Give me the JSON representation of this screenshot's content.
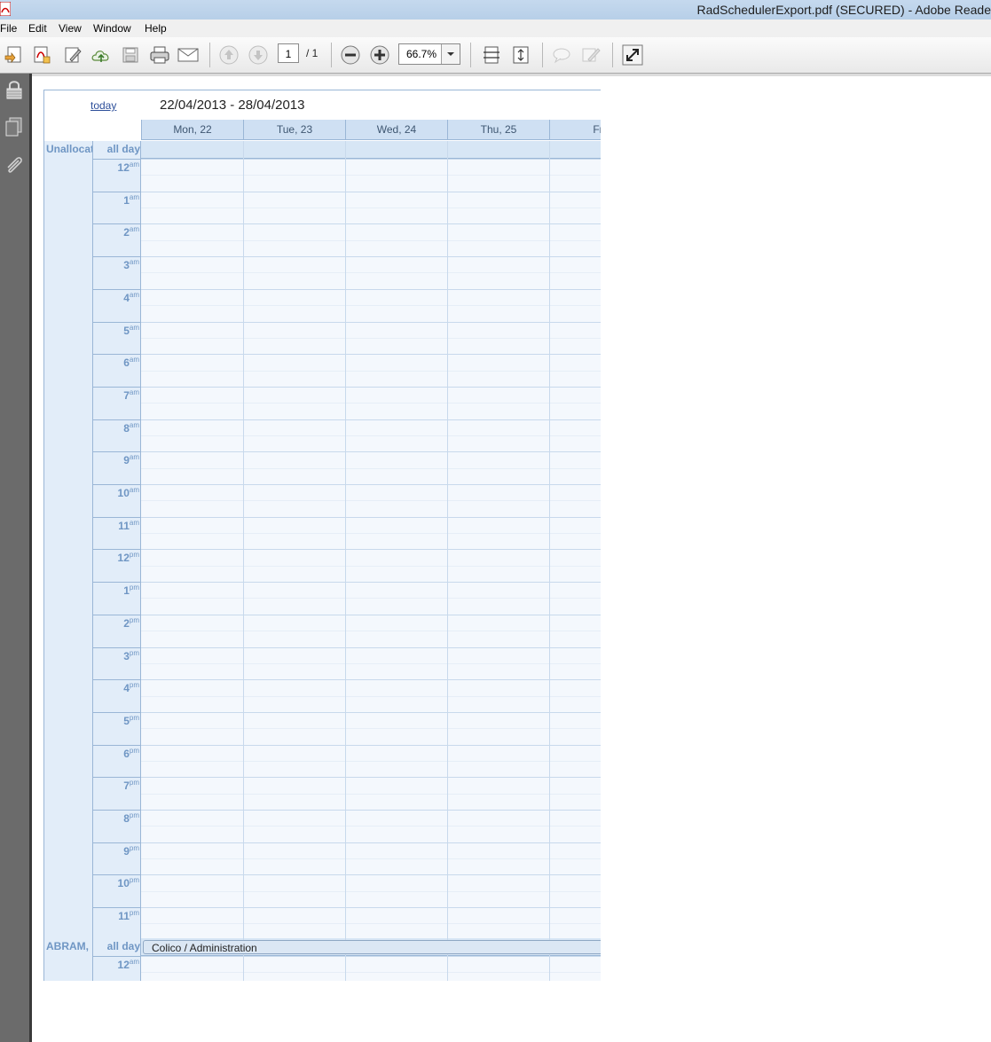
{
  "window": {
    "title": "RadSchedulerExport.pdf (SECURED) - Adobe Reade"
  },
  "menu": [
    "File",
    "Edit",
    "View",
    "Window",
    "Help"
  ],
  "toolbar": {
    "page_current": "1",
    "page_total": "/ 1",
    "zoom": "66.7%",
    "icons": [
      "create-pdf-icon",
      "export-pdf-icon",
      "edit-icon",
      "upload-icon",
      "save-icon",
      "print-icon",
      "email-icon",
      "previous-page-icon",
      "next-page-icon",
      "zoom-out-icon",
      "zoom-in-icon",
      "fit-page-icon",
      "fit-width-icon",
      "comment-icon",
      "sign-icon",
      "full-screen-icon"
    ]
  },
  "left_panel": {
    "icons": [
      "lock-icon",
      "pages-icon",
      "attachment-icon"
    ]
  },
  "scheduler": {
    "today_label": "today",
    "date_range": "22/04/2013 - 28/04/2013",
    "days": [
      "Mon, 22",
      "Tue, 23",
      "Wed, 24",
      "Thu, 25",
      "Fri,"
    ],
    "resources": [
      {
        "name": "Unallocat"
      },
      {
        "name": "ABRAM, I"
      }
    ],
    "all_day_label": "all day",
    "hours": [
      {
        "h": "12",
        "p": "am"
      },
      {
        "h": "1",
        "p": "am"
      },
      {
        "h": "2",
        "p": "am"
      },
      {
        "h": "3",
        "p": "am"
      },
      {
        "h": "4",
        "p": "am"
      },
      {
        "h": "5",
        "p": "am"
      },
      {
        "h": "6",
        "p": "am"
      },
      {
        "h": "7",
        "p": "am"
      },
      {
        "h": "8",
        "p": "am"
      },
      {
        "h": "9",
        "p": "am"
      },
      {
        "h": "10",
        "p": "am"
      },
      {
        "h": "11",
        "p": "am"
      },
      {
        "h": "12",
        "p": "pm"
      },
      {
        "h": "1",
        "p": "pm"
      },
      {
        "h": "2",
        "p": "pm"
      },
      {
        "h": "3",
        "p": "pm"
      },
      {
        "h": "4",
        "p": "pm"
      },
      {
        "h": "5",
        "p": "pm"
      },
      {
        "h": "6",
        "p": "pm"
      },
      {
        "h": "7",
        "p": "pm"
      },
      {
        "h": "8",
        "p": "pm"
      },
      {
        "h": "9",
        "p": "pm"
      },
      {
        "h": "10",
        "p": "pm"
      },
      {
        "h": "11",
        "p": "pm"
      }
    ],
    "second_resource_first_hour": {
      "h": "12",
      "p": "am"
    },
    "event": {
      "label": "Colico / Administration"
    }
  }
}
